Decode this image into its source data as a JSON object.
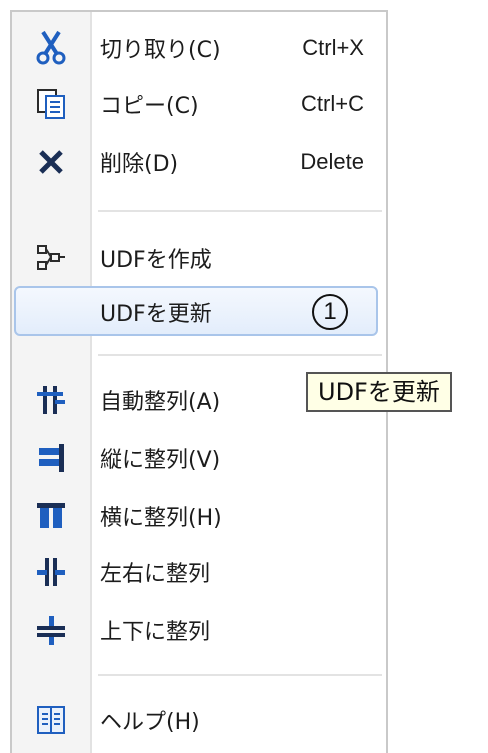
{
  "menu": {
    "items": [
      {
        "icon": "scissors-icon",
        "label": "切り取り(C)",
        "shortcut": "Ctrl+X"
      },
      {
        "icon": "copy-icon",
        "label": "コピー(C)",
        "shortcut": "Ctrl+C"
      },
      {
        "icon": "delete-x-icon",
        "label": "削除(D)",
        "shortcut": "Delete"
      },
      {
        "icon": "udf-create-icon",
        "label": "UDFを作成",
        "shortcut": ""
      },
      {
        "icon": "",
        "label": "UDFを更新",
        "shortcut": "",
        "badge": "1"
      },
      {
        "icon": "auto-align-icon",
        "label": "自動整列(A)",
        "shortcut": ""
      },
      {
        "icon": "align-vertical-icon",
        "label": "縦に整列(V)",
        "shortcut": ""
      },
      {
        "icon": "align-horizontal-icon",
        "label": "横に整列(H)",
        "shortcut": ""
      },
      {
        "icon": "align-left-right-icon",
        "label": "左右に整列",
        "shortcut": ""
      },
      {
        "icon": "align-top-bottom-icon",
        "label": "上下に整列",
        "shortcut": ""
      },
      {
        "icon": "help-icon",
        "label": "ヘルプ(H)",
        "shortcut": ""
      }
    ]
  },
  "tooltip": {
    "text": "UDFを更新"
  },
  "colors": {
    "icon_blue": "#1f5fbf",
    "highlight_border": "#a9c5ea",
    "tooltip_bg": "#ffffe6"
  }
}
